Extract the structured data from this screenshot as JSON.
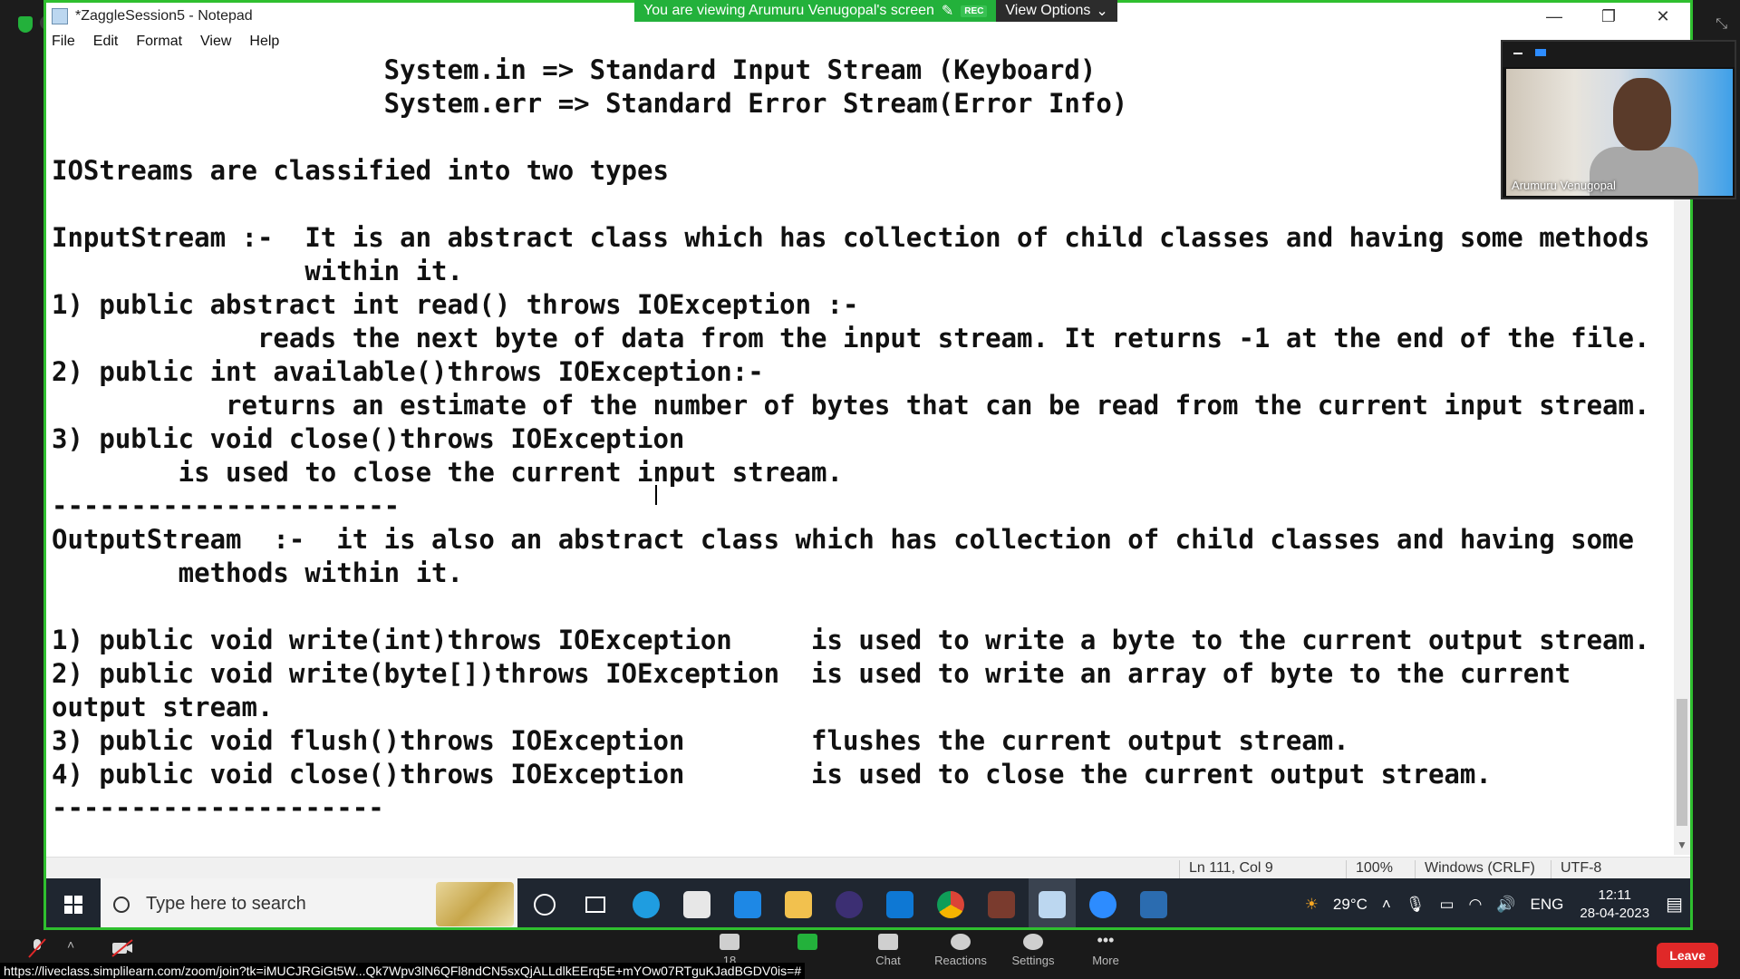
{
  "notepad": {
    "title": "*ZaggleSession5 - Notepad",
    "menu": [
      "File",
      "Edit",
      "Format",
      "View",
      "Help"
    ],
    "lines": [
      "                     System.in => Standard Input Stream (Keyboard)",
      "                     System.err => Standard Error Stream(Error Info)",
      "",
      "IOStreams are classified into two types",
      "",
      "InputStream :-  It is an abstract class which has collection of child classes and having some methods",
      "                within it.",
      "1) public abstract int read() throws IOException :-",
      "             reads the next byte of data from the input stream. It returns -1 at the end of the file.",
      "2) public int available()throws IOException:-",
      "           returns an estimate of the number of bytes that can be read from the current input stream.",
      "3) public void close()throws IOException",
      "        is used to close the current input stream.",
      "----------------------",
      "OutputStream  :-  it is also an abstract class which has collection of child classes and having some",
      "        methods within it.",
      "",
      "1) public void write(int)throws IOException     is used to write a byte to the current output stream.",
      "2) public void write(byte[])throws IOException  is used to write an array of byte to the current",
      "output stream.",
      "3) public void flush()throws IOException        flushes the current output stream.",
      "4) public void close()throws IOException        is used to close the current output stream.",
      "---------------------"
    ],
    "status": {
      "position": "Ln 111, Col 9",
      "zoom": "100%",
      "line_ending": "Windows (CRLF)",
      "encoding": "UTF-8"
    }
  },
  "taskbar": {
    "search_placeholder": "Type here to search",
    "temperature": "29°C",
    "language": "ENG",
    "time": "12:11",
    "date": "28-04-2023"
  },
  "zoom": {
    "share_banner": "You are viewing Arumuru Venugopal's screen",
    "rec_label": "REC",
    "view_options": "View Options",
    "participant_name": "Arumuru Venugopal",
    "participants_count": "18",
    "buttons": [
      "Chat",
      "Reactions",
      "Settings",
      "More"
    ],
    "leave": "Leave",
    "url": "https://liveclass.simplilearn.com/zoom/join?tk=iMUCJRGiGt5W...Qk7Wpv3lN6QFl8ndCN5sxQjALLdlkEErq5E+mYOw07RTguKJadBGDV0is=#"
  },
  "colors": {
    "share_border": "#2fbf2f",
    "taskbar_bg": "#1f2630",
    "leave_red": "#e02828"
  }
}
